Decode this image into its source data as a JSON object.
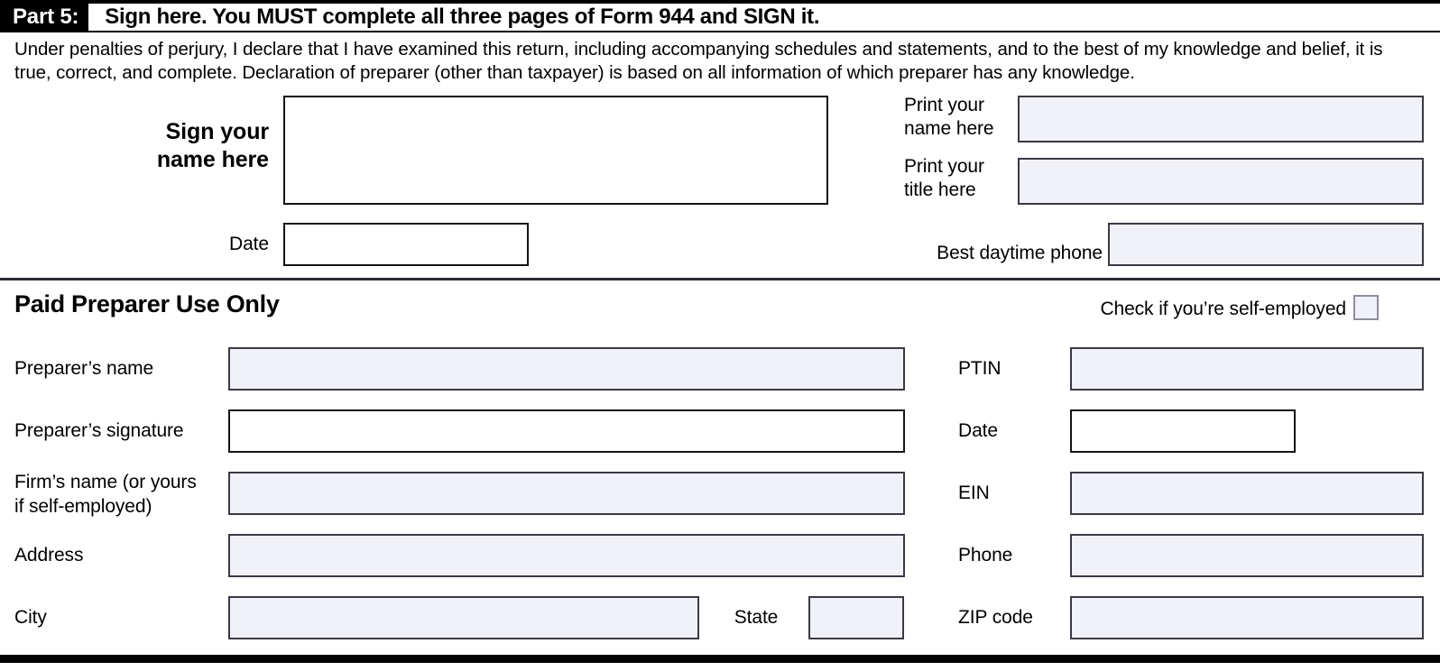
{
  "header": {
    "part_tag": "Part 5:",
    "part_title": "Sign here. You MUST complete all three pages of Form 944 and SIGN it."
  },
  "perjury_statement": "Under penalties of perjury, I declare that I have examined this return, including accompanying schedules and statements, and to the best of my knowledge and belief, it is true, correct, and complete. Declaration of preparer (other than taxpayer) is based on all information of which preparer has any knowledge.",
  "signature_section": {
    "sign_name_label_line1": "Sign your",
    "sign_name_label_line2": "name here",
    "signature_value": "",
    "date_label": "Date",
    "date_value": "",
    "print_name_label_line1": "Print your",
    "print_name_label_line2": "name here",
    "print_name_value": "",
    "print_title_label_line1": "Print your",
    "print_title_label_line2": "title here",
    "print_title_value": "",
    "best_phone_label": "Best daytime phone",
    "best_phone_value": ""
  },
  "paid_preparer": {
    "title": "Paid Preparer Use Only",
    "self_employed_label": "Check if you’re self-employed",
    "self_employed_checked": false,
    "left_fields": [
      {
        "label": "Preparer’s name",
        "value": ""
      },
      {
        "label": "Preparer’s signature",
        "value": ""
      },
      {
        "label_line1": "Firm’s name (or yours",
        "label_line2": "if self-employed)",
        "value": ""
      },
      {
        "label": "Address",
        "value": ""
      },
      {
        "label": "City",
        "value": ""
      }
    ],
    "state_label": "State",
    "state_value": "",
    "right_fields": [
      {
        "label": "PTIN",
        "value": ""
      },
      {
        "label": "Date",
        "value": ""
      },
      {
        "label": "EIN",
        "value": ""
      },
      {
        "label": "Phone",
        "value": ""
      },
      {
        "label": "ZIP code",
        "value": ""
      }
    ]
  },
  "colors": {
    "field_fill": "#f1f1fa",
    "field_border": "#3a3a46",
    "rule": "#000000",
    "checkbox_border": "#8e8e9c"
  }
}
